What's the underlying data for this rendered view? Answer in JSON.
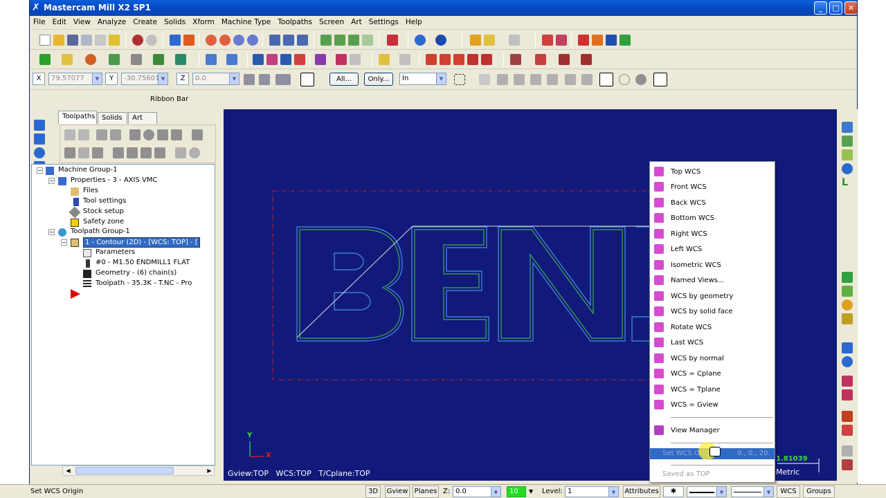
{
  "window": {
    "title": "Mastercam Mill X2 SP1",
    "controls": {
      "minimize": "_",
      "maximize": "□",
      "close": "✕"
    }
  },
  "menu": [
    "File",
    "Edit",
    "View",
    "Analyze",
    "Create",
    "Solids",
    "Xform",
    "Machine Type",
    "Toolpaths",
    "Screen",
    "Art",
    "Settings",
    "Help"
  ],
  "ribbon": {
    "x_label": "X",
    "x_value": "79.57077",
    "y_label": "Y",
    "y_value": "-30.75601",
    "z_label": "Z",
    "z_value": "0.0",
    "all_button": "All...",
    "only_button": "Only...",
    "mode_value": "In",
    "caption": "Ribbon Bar"
  },
  "manager": {
    "tabs": [
      "Toolpaths",
      "Solids",
      "Art"
    ],
    "tree": {
      "machine_group": "Machine Group-1",
      "properties": "Properties - 3 - AXIS VMC",
      "files": "Files",
      "tool_settings": "Tool settings",
      "stock_setup": "Stock setup",
      "safety_zone": "Safety zone",
      "toolpath_group": "Toolpath Group-1",
      "operation": "1 - Contour (2D) - [WCS: TOP] - [",
      "parameters": "Parameters",
      "tool": "#0 - M1.50 ENDMILL1 FLAT",
      "geometry": "Geometry - (6) chain(s)",
      "toolpath": "Toolpath - 35.3K - T.NC - Pro"
    }
  },
  "viewport": {
    "axis_y": "Y",
    "axis_x": "X",
    "status": "Gview:TOP   WCS:TOP   T/Cplane:TOP",
    "scale_value": "1.81039",
    "units": "Metric",
    "part_text": "BENZ"
  },
  "context_menu": {
    "items": [
      {
        "label": "Top WCS",
        "color": "#d64bd0"
      },
      {
        "label": "Front WCS",
        "color": "#d64bd0"
      },
      {
        "label": "Back WCS",
        "color": "#d64bd0"
      },
      {
        "label": "Bottom WCS",
        "color": "#d64bd0"
      },
      {
        "label": "Right WCS",
        "color": "#d64bd0"
      },
      {
        "label": "Left WCS",
        "color": "#d64bd0"
      },
      {
        "label": "Isometric WCS",
        "color": "#d64bd0"
      },
      {
        "label": "Named Views...",
        "color": "#d64bd0"
      },
      {
        "label": "WCS by geometry",
        "color": "#d64bd0"
      },
      {
        "label": "WCS by solid face",
        "color": "#d64bd0"
      },
      {
        "label": "Rotate WCS",
        "color": "#d64bd0"
      },
      {
        "label": "Last WCS",
        "color": "#d64bd0"
      },
      {
        "label": "WCS by normal",
        "color": "#d64bd0"
      },
      {
        "label": "WCS = Cplane",
        "color": "#d64bd0"
      },
      {
        "label": "WCS = Tplane",
        "color": "#d64bd0"
      },
      {
        "label": "WCS = Gview",
        "color": "#d64bd0"
      }
    ],
    "view_manager": "View Manager",
    "set_origin": "Set WCS Origin",
    "set_origin_values": "0., 0., 20.",
    "saved_as": "Saved as TOP"
  },
  "statusbar": {
    "message": "Set WCS Origin",
    "btn_3d": "3D",
    "btn_gview": "Gview",
    "btn_planes": "Planes",
    "z_label": "Z:",
    "z_value": "0.0",
    "color_value": "10",
    "level_label": "Level:",
    "level_value": "1",
    "attributes": "Attributes",
    "btn_wcs": "WCS",
    "btn_groups": "Groups"
  },
  "colors": {
    "viewport_bg": "#111a7a",
    "part_outline": "#4a8fe0",
    "part_inner": "#3fae4a",
    "stock_dashed": "#d02020",
    "highlight": "#316ac5"
  }
}
